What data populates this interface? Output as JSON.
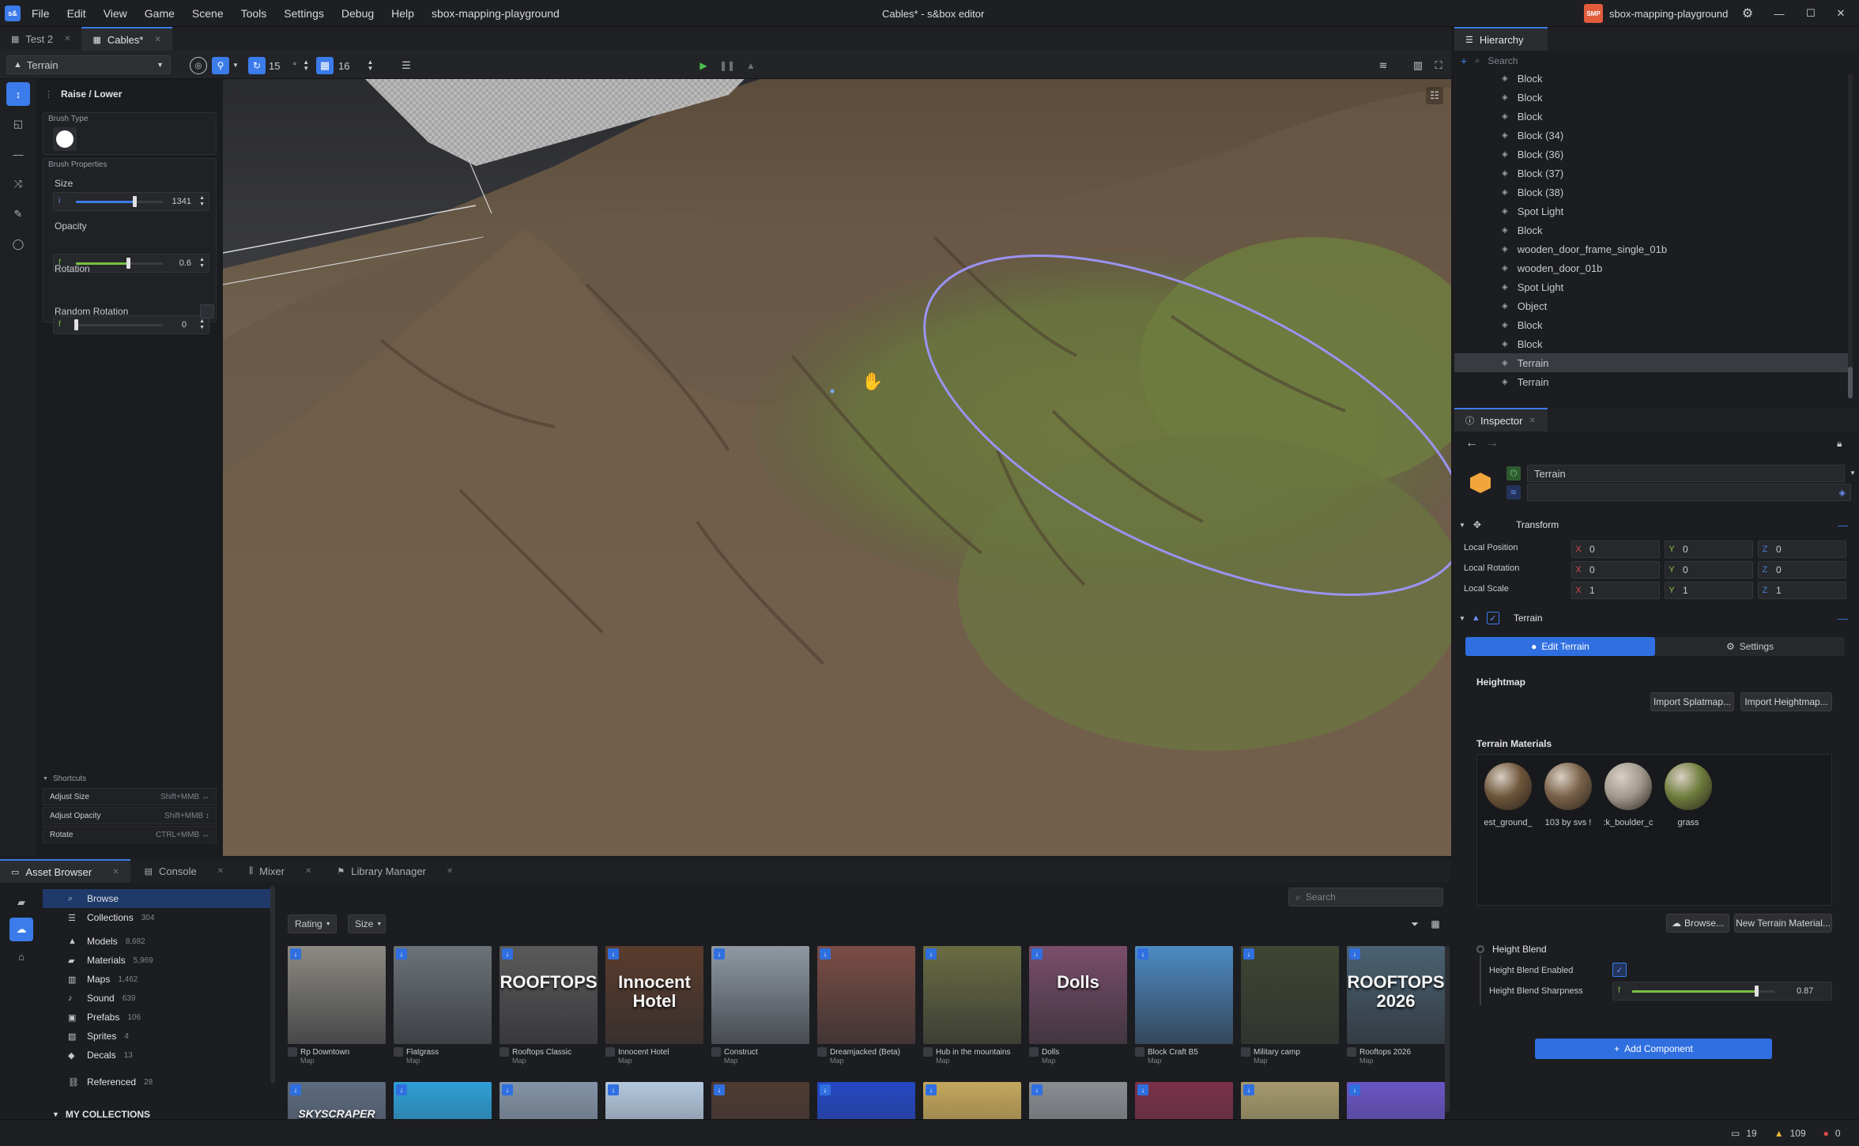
{
  "window": {
    "title": "Cables* - s&box editor",
    "project": "sbox-mapping-playground",
    "project_badge": "SMP",
    "app_logo": "s&"
  },
  "menu": [
    "File",
    "Edit",
    "View",
    "Game",
    "Scene",
    "Tools",
    "Settings",
    "Debug",
    "Help",
    "sbox-mapping-playground"
  ],
  "scene_tabs": [
    {
      "label": "Test 2",
      "active": false
    },
    {
      "label": "Cables*",
      "active": true
    }
  ],
  "toolbar": {
    "mode": "Terrain",
    "angle": "15",
    "angle_unit": "°",
    "grid": "16"
  },
  "tool_panel": {
    "title": "Raise / Lower",
    "brush_type_label": "Brush Type",
    "brush_props_label": "Brush Properties",
    "size": {
      "label": "Size",
      "value": "1341",
      "prefix": "i",
      "fraction": 0.67
    },
    "opacity": {
      "label": "Opacity",
      "value": "0.6",
      "prefix": "f",
      "fraction": 0.6
    },
    "rotation": {
      "label": "Rotation",
      "value": "0",
      "prefix": "f",
      "fraction": 0.0
    },
    "random_rotation": "Random Rotation",
    "shortcuts_label": "Shortcuts",
    "shortcuts": [
      {
        "action": "Adjust Size",
        "keys": "Shift+MMB ↔"
      },
      {
        "action": "Adjust Opacity",
        "keys": "Shift+MMB ↕"
      },
      {
        "action": "Rotate",
        "keys": "CTRL+MMB ↔"
      }
    ]
  },
  "hierarchy": {
    "tab": "Hierarchy",
    "search_placeholder": "Search",
    "items": [
      "Block",
      "Block",
      "Block",
      "Block (34)",
      "Block (36)",
      "Block (37)",
      "Block (38)",
      "Spot Light",
      "Block",
      "wooden_door_frame_single_01b",
      "wooden_door_01b",
      "Spot Light",
      "Object",
      "Block",
      "Block",
      "Terrain",
      "Terrain"
    ],
    "selected_index": 15
  },
  "inspector": {
    "tab": "Inspector",
    "object_name": "Terrain",
    "transform_label": "Transform",
    "rows": [
      {
        "label": "Local Position",
        "x": "0",
        "y": "0",
        "z": "0"
      },
      {
        "label": "Local Rotation",
        "x": "0",
        "y": "0",
        "z": "0"
      },
      {
        "label": "Local Scale",
        "x": "1",
        "y": "1",
        "z": "1"
      }
    ],
    "component_label": "Terrain",
    "edit_terrain": "Edit Terrain",
    "settings": "Settings",
    "heightmap_label": "Heightmap",
    "import_splatmap": "Import Splatmap...",
    "import_heightmap": "Import Heightmap...",
    "materials_label": "Terrain Materials",
    "materials": [
      {
        "name": "est_ground_",
        "color": "#6e553a"
      },
      {
        "name": "103 by svs !",
        "color": "#7a6148"
      },
      {
        "name": ":k_boulder_c",
        "color": "#a39a8f"
      },
      {
        "name": "grass",
        "color": "#6f7d3d"
      }
    ],
    "browse": "Browse...",
    "new_material": "New Terrain Material...",
    "height_blend_label": "Height Blend",
    "height_blend_enabled": "Height Blend Enabled",
    "height_blend_sharpness": "Height Blend Sharpness",
    "sharpness_value": "0.87",
    "sharpness_fraction": 0.87,
    "add_component": "Add Component"
  },
  "bottom_tabs": [
    "Asset Browser",
    "Console",
    "Mixer",
    "Library Manager"
  ],
  "asset_sidebar": {
    "items": [
      {
        "label": "Browse",
        "count": "",
        "icon": "search-icon"
      },
      {
        "label": "Collections",
        "count": "304",
        "icon": "list-icon"
      },
      {
        "label": "Models",
        "count": "8,682",
        "icon": "model-icon"
      },
      {
        "label": "Materials",
        "count": "5,969",
        "icon": "material-icon"
      },
      {
        "label": "Maps",
        "count": "1,462",
        "icon": "map-icon"
      },
      {
        "label": "Sound",
        "count": "639",
        "icon": "sound-icon"
      },
      {
        "label": "Prefabs",
        "count": "106",
        "icon": "prefab-icon"
      },
      {
        "label": "Sprites",
        "count": "4",
        "icon": "sprite-icon"
      },
      {
        "label": "Decals",
        "count": "13",
        "icon": "decal-icon"
      },
      {
        "label": "Referenced",
        "count": "28",
        "icon": "link-icon"
      }
    ],
    "my_collections": "MY COLLECTIONS"
  },
  "asset_filters": {
    "rating": "Rating",
    "size": "Size",
    "search_placeholder": "Search"
  },
  "assets": [
    {
      "name": "Rp Downtown",
      "type": "Map",
      "bg": "#8c8a83",
      "overlay": ""
    },
    {
      "name": "Flatgrass",
      "type": "Map",
      "bg": "#6c7378",
      "overlay": ""
    },
    {
      "name": "Rooftops Classic",
      "type": "Map",
      "bg": "#5a5a5a",
      "overlay": "ROOFTOPS"
    },
    {
      "name": "Innocent Hotel",
      "type": "Map",
      "bg": "#5b3c2c",
      "overlay": "Innocent Hotel"
    },
    {
      "name": "Construct",
      "type": "Map",
      "bg": "#8f99a3",
      "overlay": ""
    },
    {
      "name": "Dreamjacked (Beta)",
      "type": "Map",
      "bg": "#7b4d44",
      "overlay": ""
    },
    {
      "name": "Hub in the mountains",
      "type": "Map",
      "bg": "#6a6d43",
      "overlay": ""
    },
    {
      "name": "Dolls",
      "type": "Map",
      "bg": "#7a4e6a",
      "overlay": "Dolls"
    },
    {
      "name": "Block Craft B5",
      "type": "Map",
      "bg": "#4d8bc4",
      "overlay": ""
    },
    {
      "name": "Military camp",
      "type": "Map",
      "bg": "#3f4632",
      "overlay": ""
    },
    {
      "name": "Rooftops 2026",
      "type": "Map",
      "bg": "#4a6272",
      "overlay": "ROOFTOPS 2026"
    }
  ],
  "assets_row2": [
    {
      "bg": "#5c6b7e",
      "overlay": "SKYSCRAPER"
    },
    {
      "bg": "#2f9fd6",
      "overlay": ""
    },
    {
      "bg": "#8494a6",
      "overlay": ""
    },
    {
      "bg": "#b4c8de",
      "overlay": ""
    },
    {
      "bg": "#4e3a32",
      "overlay": ""
    },
    {
      "bg": "#2448c4",
      "overlay": ""
    },
    {
      "bg": "#c4a75c",
      "overlay": ""
    },
    {
      "bg": "#8a8d92",
      "overlay": ""
    },
    {
      "bg": "#7a3148",
      "overlay": ""
    },
    {
      "bg": "#a59a6c",
      "overlay": ""
    },
    {
      "bg": "#6a55c4",
      "overlay": ""
    }
  ],
  "status": {
    "messages": "19",
    "warnings": "109",
    "errors": "0"
  }
}
